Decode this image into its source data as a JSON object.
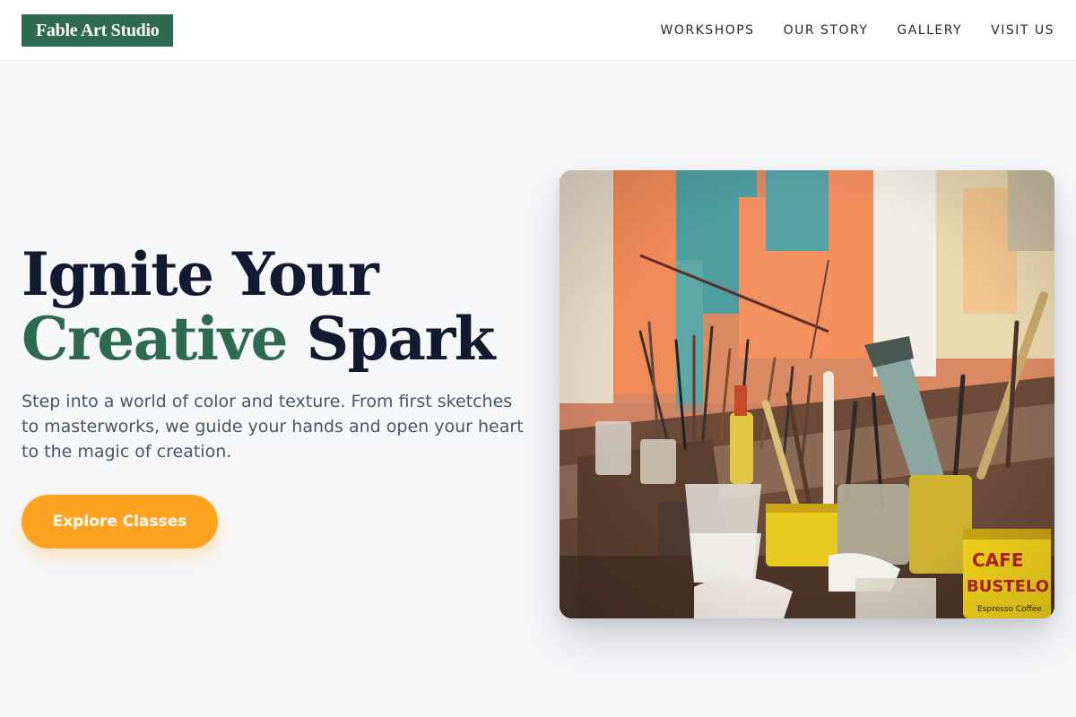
{
  "brand": {
    "logo_text": "Fable Art Studio"
  },
  "nav": {
    "items": [
      {
        "label": "WORKSHOPS"
      },
      {
        "label": "OUR STORY"
      },
      {
        "label": "GALLERY"
      },
      {
        "label": "VISIT US"
      }
    ]
  },
  "hero": {
    "headline_line1": "Ignite Your",
    "headline_accent": "Creative",
    "headline_rest": " Spark",
    "subtext": "Step into a world of color and texture. From first sketches to masterworks, we guide your hands and open your heart to the magic of creation.",
    "cta_label": "Explore Classes",
    "image": {
      "subject": "art studio workbench with paint brushes in tins",
      "can_label_1": "CAFE",
      "can_label_2": "BUSTELO",
      "can_label_3": "Espresso Coffee"
    }
  },
  "colors": {
    "brand_green": "#2d6a4f",
    "accent_orange": "#ffa21f",
    "headline_dark": "#111a2e",
    "page_bg": "#f7f8fa"
  }
}
